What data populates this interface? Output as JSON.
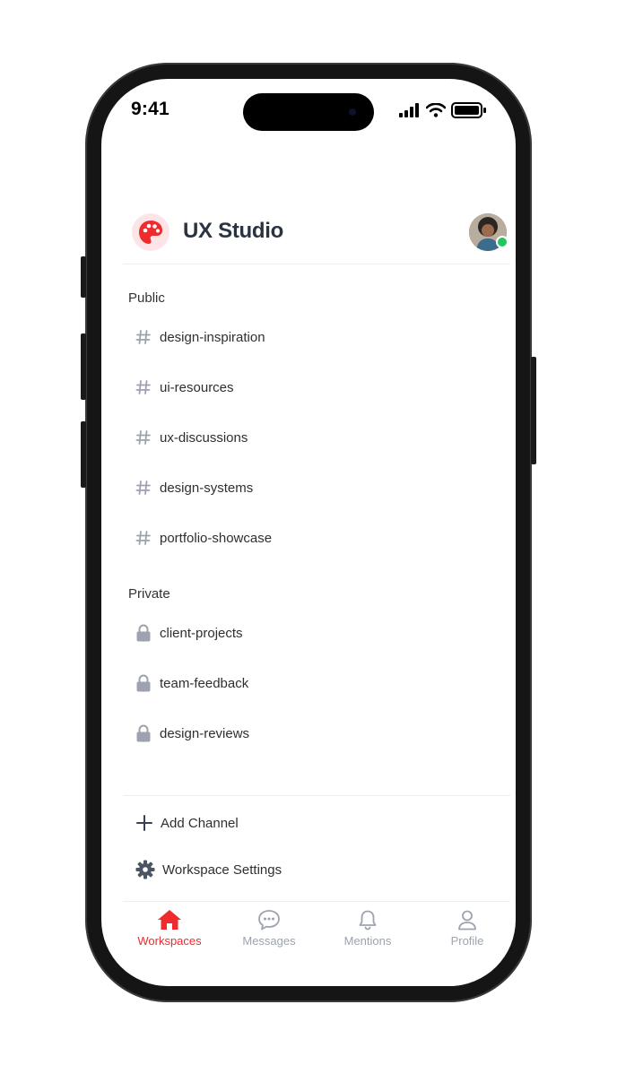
{
  "status_bar": {
    "time": "9:41"
  },
  "workspace": {
    "name": "UX Studio"
  },
  "sections": {
    "public_title": "Public",
    "private_title": "Private"
  },
  "public_channels": [
    "design-inspiration",
    "ui-resources",
    "ux-discussions",
    "design-systems",
    "portfolio-showcase"
  ],
  "private_channels": [
    "client-projects",
    "team-feedback",
    "design-reviews"
  ],
  "actions": {
    "add_channel": "Add Channel",
    "workspace_settings": "Workspace Settings"
  },
  "tabs": [
    {
      "label": "Workspaces",
      "icon": "home-icon",
      "active": true
    },
    {
      "label": "Messages",
      "icon": "chat-icon",
      "active": false
    },
    {
      "label": "Mentions",
      "icon": "bell-icon",
      "active": false
    },
    {
      "label": "Profile",
      "icon": "user-icon",
      "active": false
    }
  ],
  "colors": {
    "accent": "#ef2b2d",
    "logo_bg": "#fde5e7",
    "inactive": "#9ca3af",
    "online": "#22c55e"
  }
}
